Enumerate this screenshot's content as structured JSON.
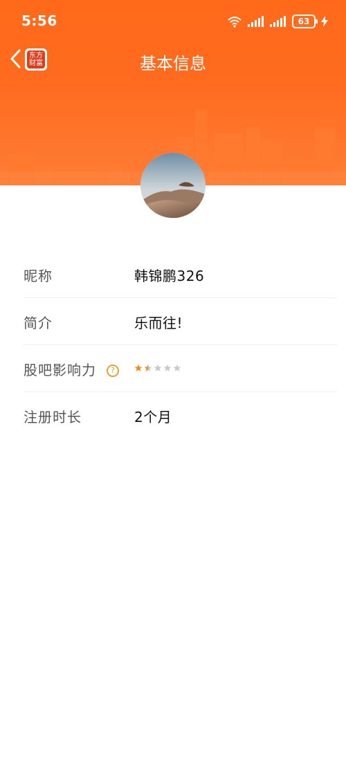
{
  "status_bar": {
    "time": "5:56",
    "battery": "63",
    "network_label": "6"
  },
  "header": {
    "title": "基本信息",
    "app_logo_line1": "东方",
    "app_logo_line2": "财富"
  },
  "profile": {
    "nickname_label": "昵称",
    "nickname_value": "韩锦鹏326",
    "intro_label": "简介",
    "intro_value": "乐而往!",
    "influence_label": "股吧影响力",
    "influence_help_icon": "question-circle-icon",
    "influence_rating": 1.5,
    "influence_max": 5,
    "registration_label": "注册时长",
    "registration_value": "2个月"
  },
  "colors": {
    "header_orange": "#ff6a1a",
    "star_active": "#f08f1f",
    "star_inactive": "#c9c9c9"
  }
}
